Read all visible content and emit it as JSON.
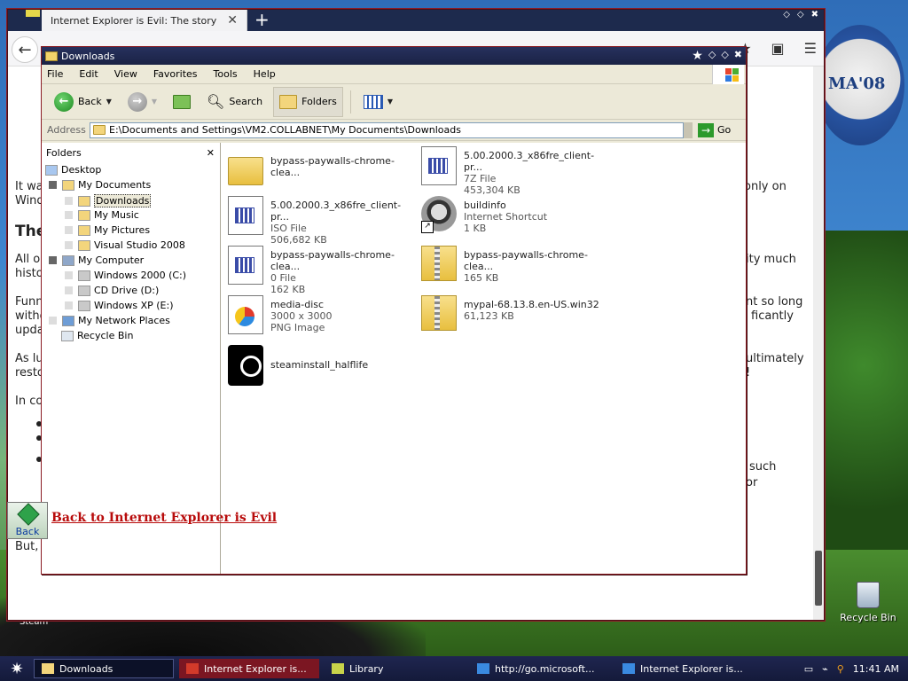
{
  "browser": {
    "tab_title": "Internet Explorer is Evil: The story",
    "tab_close": "✕",
    "new_tab": "+",
    "back_glyph": "←",
    "page_snippets": [
      {
        "text": "It wa",
        "cls": ""
      },
      {
        "text": "Wind",
        "cls": ""
      },
      {
        "text": "The",
        "cls": "h"
      },
      {
        "text": "All o",
        "cls": ""
      },
      {
        "text": "histo",
        "cls": ""
      },
      {
        "text": "Funn",
        "cls": ""
      },
      {
        "text": "witho",
        "cls": ""
      },
      {
        "text": "upda",
        "cls": ""
      },
      {
        "text": "As lu",
        "cls": ""
      },
      {
        "text": "resto",
        "cls": ""
      },
      {
        "text": "In co",
        "cls": ""
      },
      {
        "text": "But,",
        "cls": ""
      },
      {
        "text": "only on",
        "cls": ""
      },
      {
        "text": "ity much",
        "cls": ""
      },
      {
        "text": "nt so long",
        "cls": ""
      },
      {
        "text": "ficantly",
        "cls": ""
      },
      {
        "text": "ultimately",
        "cls": ""
      },
      {
        "text": "!",
        "cls": ""
      },
      {
        "text": "such",
        "cls": ""
      },
      {
        "text": "or",
        "cls": ""
      }
    ],
    "back_button_label": "Back",
    "back_link": "Back to Internet Explorer is Evil"
  },
  "explorer": {
    "title": "Downloads",
    "menu": [
      "File",
      "Edit",
      "View",
      "Favorites",
      "Tools",
      "Help"
    ],
    "toolbar": {
      "back": "Back",
      "search": "Search",
      "folders": "Folders"
    },
    "address_label": "Address",
    "address_value": "E:\\Documents and Settings\\VM2.COLLABNET\\My Documents\\Downloads",
    "go": "Go",
    "folders_header": "Folders",
    "tree": [
      "Desktop",
      "My Documents",
      "Downloads",
      "My Music",
      "My Pictures",
      "Visual Studio 2008",
      "My Computer",
      "Windows 2000 (C:)",
      "CD Drive (D:)",
      "Windows XP (E:)",
      "My Network Places",
      "Recycle Bin"
    ],
    "files": [
      {
        "name": "bypass-paywalls-chrome-clea...",
        "line2": "",
        "line3": "",
        "icon": "folder"
      },
      {
        "name": "5.00.2000.3_x86fre_client-pr...",
        "line2": "7Z File",
        "line3": "453,304 KB",
        "icon": "doc"
      },
      {
        "name": "5.00.2000.3_x86fre_client-pr...",
        "line2": "ISO File",
        "line3": "506,682 KB",
        "icon": "doc"
      },
      {
        "name": "buildinfo",
        "line2": "Internet Shortcut",
        "line3": "1 KB",
        "icon": "raccoon"
      },
      {
        "name": "bypass-paywalls-chrome-clea...",
        "line2": "0 File",
        "line3": "162 KB",
        "icon": "doc"
      },
      {
        "name": "bypass-paywalls-chrome-clea...",
        "line2": "165 KB",
        "line3": "",
        "icon": "zip"
      },
      {
        "name": "media-disc",
        "line2": "3000 x 3000",
        "line3": "PNG Image",
        "icon": "png"
      },
      {
        "name": "mypal-68.13.8.en-US.win32",
        "line2": "61,123 KB",
        "line3": "",
        "icon": "zip"
      },
      {
        "name": "steaminstall_halflife",
        "line2": "",
        "line3": "",
        "icon": "steam"
      }
    ]
  },
  "desktop": {
    "logo_text": "MA'08",
    "recycle_label": "Recycle Bin",
    "steam_label": "Steam"
  },
  "taskbar": {
    "start_glyph": "✷",
    "tasks": [
      "Downloads",
      "Internet Explorer is...",
      "Library",
      "http://go.microsoft...",
      "Internet Explorer is..."
    ],
    "clock": "11:41 AM"
  }
}
